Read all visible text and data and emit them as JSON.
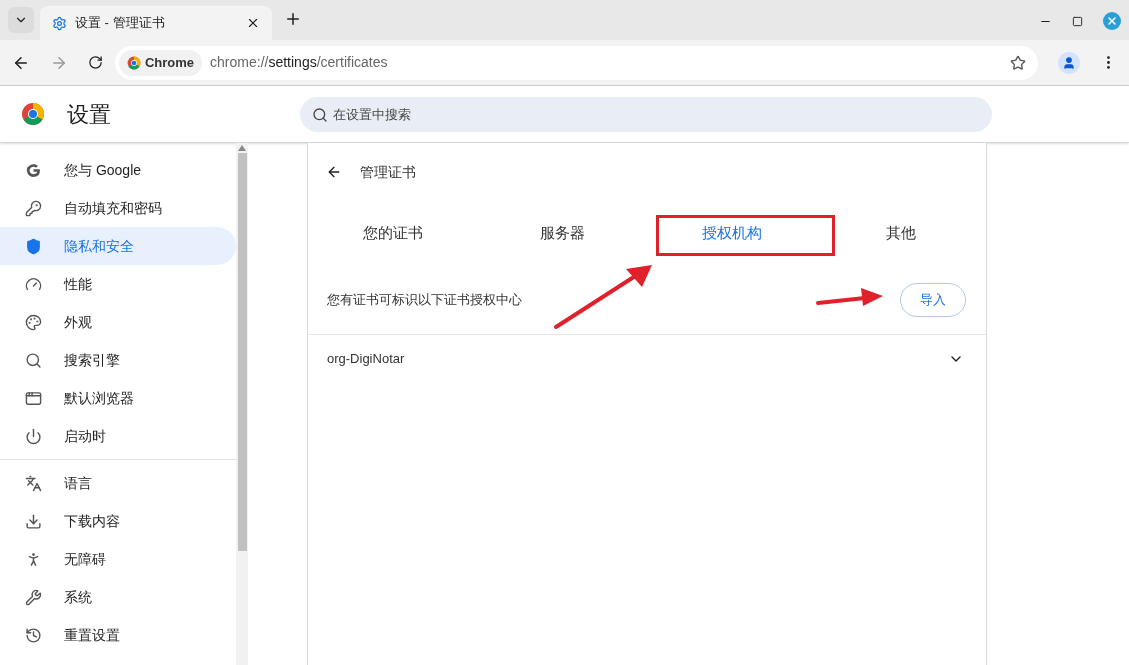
{
  "browser": {
    "tabs": [
      {
        "title": "设置 - 管理证书",
        "selected": true
      }
    ],
    "address_bar": {
      "chip": "Chrome",
      "url_host": "chrome://",
      "url_path": "settings",
      "url_rest": "/certificates"
    }
  },
  "header": {
    "title": "设置",
    "search": {
      "placeholder": "在设置中搜索"
    }
  },
  "sidebar": {
    "groups": [
      [
        {
          "label": "您与 Google",
          "selected": false
        },
        {
          "label": "自动填充和密码",
          "selected": false
        },
        {
          "label": "隐私和安全",
          "selected": true
        },
        {
          "label": "性能",
          "selected": false
        },
        {
          "label": "外观",
          "selected": false
        },
        {
          "label": "搜索引擎",
          "selected": false
        },
        {
          "label": "默认浏览器",
          "selected": false
        },
        {
          "label": "启动时",
          "selected": false
        }
      ],
      [
        {
          "label": "语言",
          "selected": false
        },
        {
          "label": "下载内容",
          "selected": false
        },
        {
          "label": "无障碍",
          "selected": false
        },
        {
          "label": "系统",
          "selected": false
        },
        {
          "label": "重置设置",
          "selected": false
        }
      ]
    ]
  },
  "page": {
    "title": "管理证书",
    "tabs": [
      {
        "label": "您的证书",
        "selected": false
      },
      {
        "label": "服务器",
        "selected": false
      },
      {
        "label": "授权机构",
        "selected": true
      },
      {
        "label": "其他",
        "selected": false
      }
    ],
    "description": "您有证书可标识以下证书授权中心",
    "import_button": "导入",
    "certificates": [
      {
        "name": "org-DigiNotar",
        "expanded": false
      }
    ]
  }
}
